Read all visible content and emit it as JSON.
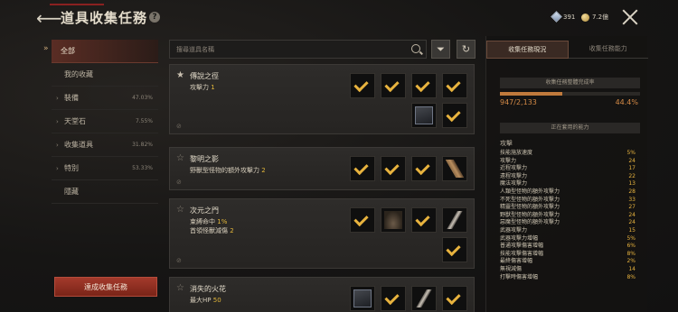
{
  "header": {
    "title": "道具收集任務",
    "help": "?"
  },
  "currency": {
    "gem_amount": "391",
    "gold_amount": "7.2億"
  },
  "nav": {
    "items": [
      {
        "label": "全部",
        "count": "",
        "expandable": false
      },
      {
        "label": "我的收藏",
        "count": "",
        "expandable": false
      },
      {
        "label": "裝備",
        "count": "47.03%",
        "expandable": true
      },
      {
        "label": "天堂石",
        "count": "7.55%",
        "expandable": true
      },
      {
        "label": "收集道具",
        "count": "31.82%",
        "expandable": true
      },
      {
        "label": "特別",
        "count": "53.33%",
        "expandable": true
      },
      {
        "label": "隱藏",
        "count": "",
        "expandable": false
      }
    ],
    "complete_button": "達成收集任務"
  },
  "search": {
    "placeholder": "搜尋道具名稱"
  },
  "cards": [
    {
      "name": "傳說之徑",
      "effects": [
        {
          "text": "攻擊力",
          "value": "1"
        }
      ],
      "favorite": true
    },
    {
      "name": "黎明之影",
      "effects": [
        {
          "text": "野獸型怪物的額外攻擊力",
          "value": "2"
        }
      ],
      "favorite": false
    },
    {
      "name": "次元之門",
      "effects": [
        {
          "text": "束縛命中",
          "value": "1%"
        },
        {
          "text": "首領怪獸減傷",
          "value": "2"
        }
      ],
      "favorite": false
    },
    {
      "name": "消失的火花",
      "effects": [
        {
          "text": "最大HP",
          "value": "50"
        }
      ],
      "favorite": false
    }
  ],
  "right_panel": {
    "tabs": [
      "收集任務現況",
      "收集任務能力"
    ],
    "progress_title": "收集任務整體完成率",
    "progress_current": "947/2,133",
    "progress_percent": "44.4%",
    "progress_fraction": 0.444,
    "abilities_title": "正在套用的能力",
    "stat_header": "攻擊",
    "stats": [
      {
        "name": "技能施放速度",
        "value": "5%"
      },
      {
        "name": "攻擊力",
        "value": "24"
      },
      {
        "name": "近程攻擊力",
        "value": "17"
      },
      {
        "name": "遠程攻擊力",
        "value": "22"
      },
      {
        "name": "魔法攻擊力",
        "value": "13"
      },
      {
        "name": "人類型怪物的額外攻擊力",
        "value": "28"
      },
      {
        "name": "不死型怪物的額外攻擊力",
        "value": "33"
      },
      {
        "name": "精靈型怪物的額外攻擊力",
        "value": "27"
      },
      {
        "name": "野獸型怪物的額外攻擊力",
        "value": "24"
      },
      {
        "name": "惡魔型怪物的額外攻擊力",
        "value": "24"
      },
      {
        "name": "武器攻擊力",
        "value": "15"
      },
      {
        "name": "武器攻擊力增幅",
        "value": "5%"
      },
      {
        "name": "普通攻擊傷害增幅",
        "value": "6%"
      },
      {
        "name": "技能攻擊傷害增幅",
        "value": "8%"
      },
      {
        "name": "最終傷害增幅",
        "value": "2%"
      },
      {
        "name": "無視減傷",
        "value": "14"
      },
      {
        "name": "打擊時傷害增幅",
        "value": "8%"
      }
    ]
  },
  "colors": {
    "accent": "#e8b33e",
    "active_tab": "#5a2d24",
    "button": "#a33a2c"
  }
}
